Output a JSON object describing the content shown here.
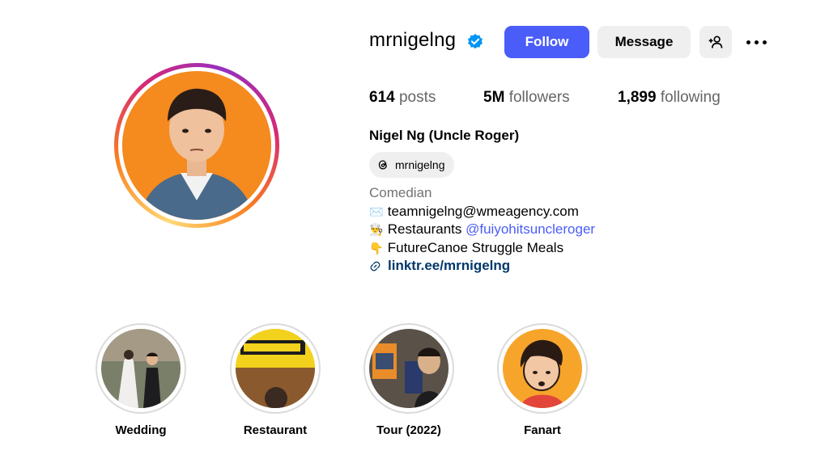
{
  "profile": {
    "username": "mrnigelng",
    "follow_label": "Follow",
    "message_label": "Message",
    "stats": {
      "posts_count": "614",
      "posts_label": "posts",
      "followers_count": "5M",
      "followers_label": "followers",
      "following_count": "1,899",
      "following_label": "following"
    },
    "full_name": "Nigel Ng (Uncle Roger)",
    "threads_handle": "mrnigelng",
    "bio": {
      "category": "Comedian",
      "line1_emoji": "✉️",
      "line1_text": "teamnigelng@wmeagency.com",
      "line2_emoji": "👨‍🍳",
      "line2_text": "Restaurants ",
      "line2_mention": "@fuiyohitsuncleroger",
      "line3_emoji": "👇",
      "line3_text": "FutureCanoe Struggle Meals",
      "link": "linktr.ee/mrnigelng"
    }
  },
  "highlights": [
    {
      "label": "Wedding"
    },
    {
      "label": "Restaurant"
    },
    {
      "label": "Tour (2022)"
    },
    {
      "label": "Fanart"
    }
  ],
  "colors": {
    "accent": "#4a5df9",
    "verified": "#0095f6",
    "link": "#00376b",
    "button_bg": "#efefef"
  },
  "icons": [
    "verified-badge-icon",
    "add-user-icon",
    "more-options-icon",
    "threads-icon",
    "link-icon"
  ]
}
